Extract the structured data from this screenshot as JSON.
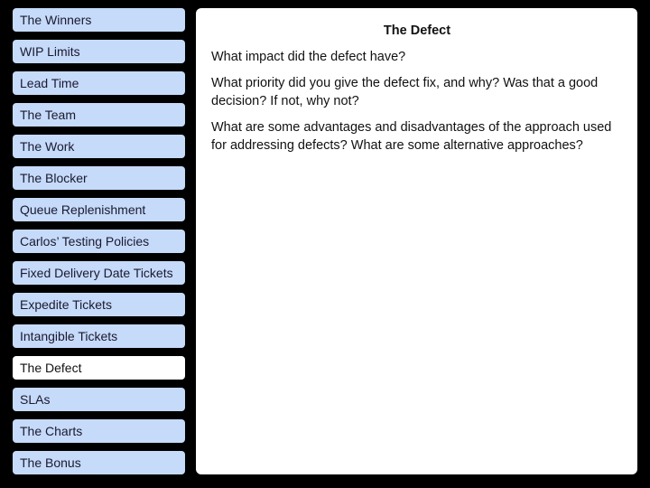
{
  "sidebar": {
    "items": [
      {
        "label": "The Winners",
        "active": false
      },
      {
        "label": "WIP Limits",
        "active": false
      },
      {
        "label": "Lead Time",
        "active": false
      },
      {
        "label": "The Team",
        "active": false
      },
      {
        "label": "The Work",
        "active": false
      },
      {
        "label": "The Blocker",
        "active": false
      },
      {
        "label": "Queue Replenishment",
        "active": false
      },
      {
        "label": "Carlos’ Testing Policies",
        "active": false
      },
      {
        "label": "Fixed Delivery Date Tickets",
        "active": false
      },
      {
        "label": "Expedite Tickets",
        "active": false
      },
      {
        "label": "Intangible Tickets",
        "active": false
      },
      {
        "label": "The Defect",
        "active": true
      },
      {
        "label": "SLAs",
        "active": false
      },
      {
        "label": "The Charts",
        "active": false
      },
      {
        "label": "The Bonus",
        "active": false
      }
    ]
  },
  "panel": {
    "title": "The Defect",
    "questions": [
      "What impact did the defect have?",
      "What priority did you give the defect fix, and why? Was that a good decision? If not, why not?",
      "What are some advantages and disadvantages of the approach used for addressing defects? What are some alternative approaches?"
    ]
  },
  "colors": {
    "nav_bg": "#c6dafa",
    "nav_active_bg": "#ffffff",
    "background": "#000000"
  }
}
